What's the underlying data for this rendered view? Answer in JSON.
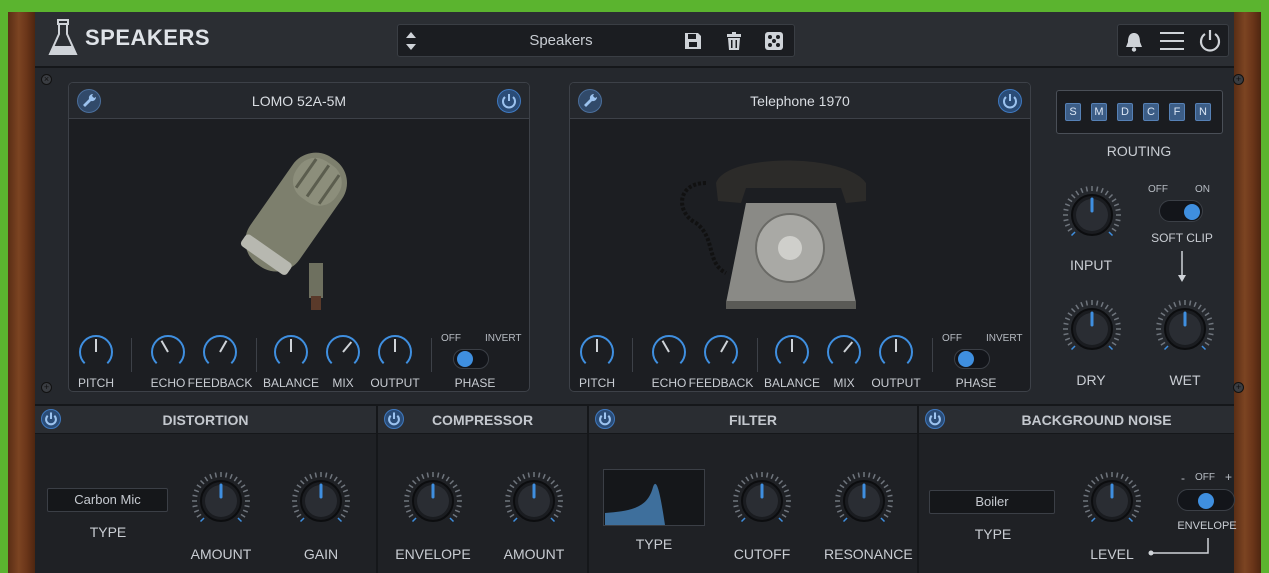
{
  "app": {
    "title": "SPEAKERS"
  },
  "preset": {
    "name": "Speakers",
    "save_icon": "save-icon",
    "delete_icon": "trash-icon",
    "random_icon": "dice-icon"
  },
  "topright": {
    "bell_icon": "bell-icon",
    "menu_icon": "menu-icon",
    "power_icon": "power-icon"
  },
  "modules": [
    {
      "title": "LOMO 52A-5M",
      "knobs": {
        "pitch": "PITCH",
        "echo": "ECHO",
        "feedback": "FEEDBACK",
        "balance": "BALANCE",
        "mix": "MIX",
        "output": "OUTPUT"
      },
      "phase": {
        "label": "PHASE",
        "off": "OFF",
        "invert": "INVERT"
      }
    },
    {
      "title": "Telephone 1970",
      "knobs": {
        "pitch": "PITCH",
        "echo": "ECHO",
        "feedback": "FEEDBACK",
        "balance": "BALANCE",
        "mix": "MIX",
        "output": "OUTPUT"
      },
      "phase": {
        "label": "PHASE",
        "off": "OFF",
        "invert": "INVERT"
      }
    }
  ],
  "routing": {
    "label": "ROUTING",
    "buttons": [
      "S",
      "M",
      "D",
      "C",
      "F",
      "N"
    ]
  },
  "side": {
    "input": "INPUT",
    "dry": "DRY",
    "wet": "WET",
    "softclip": {
      "label": "SOFT CLIP",
      "off": "OFF",
      "on": "ON"
    }
  },
  "sections": {
    "distortion": {
      "title": "DISTORTION",
      "type_value": "Carbon Mic",
      "type_label": "TYPE",
      "amount": "AMOUNT",
      "gain": "GAIN"
    },
    "compressor": {
      "title": "COMPRESSOR",
      "envelope": "ENVELOPE",
      "amount": "AMOUNT"
    },
    "filter": {
      "title": "FILTER",
      "type_label": "TYPE",
      "cutoff": "CUTOFF",
      "resonance": "RESONANCE"
    },
    "noise": {
      "title": "BACKGROUND NOISE",
      "type_value": "Boiler",
      "type_label": "TYPE",
      "level": "LEVEL",
      "minus": "-",
      "off": "OFF",
      "plus": "+",
      "envelope": "ENVELOPE"
    }
  },
  "colors": {
    "accent": "#3f8fe0",
    "panel": "#25282d",
    "bg": "#5bb42f",
    "wood": "#6a3519"
  }
}
